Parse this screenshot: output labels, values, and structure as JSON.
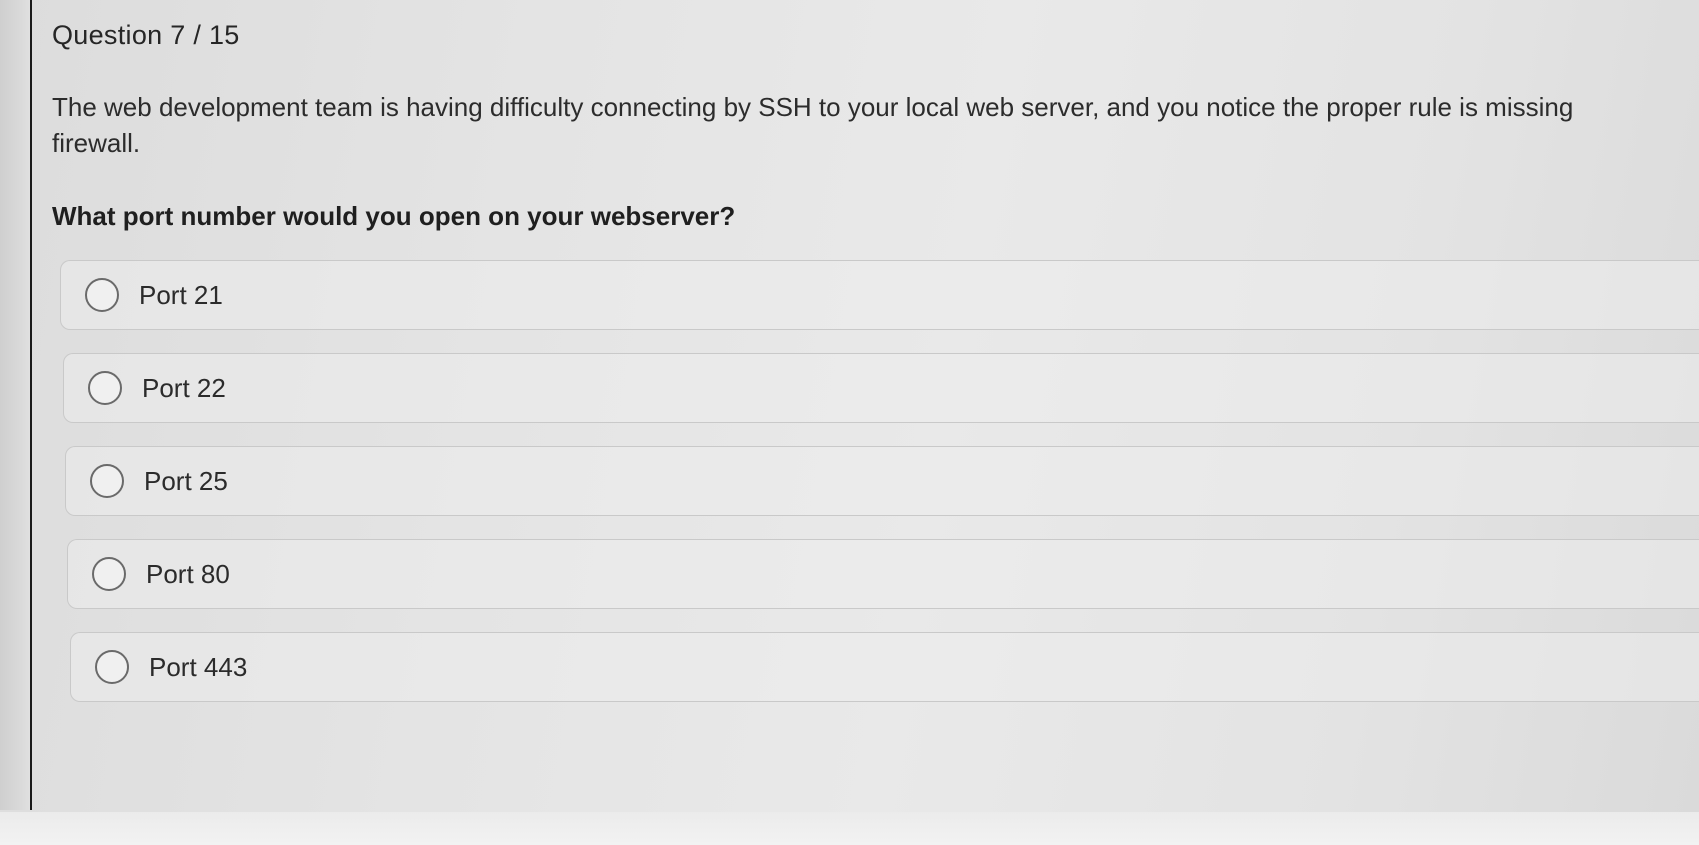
{
  "quiz": {
    "header": "Question 7 / 15",
    "question_text": "The web development team is having difficulty connecting by SSH to your local web server, and you notice the proper rule is missing",
    "question_text_line2": "firewall.",
    "prompt": "What port number would you open on your webserver?",
    "options": [
      {
        "label": "Port 21"
      },
      {
        "label": "Port 22"
      },
      {
        "label": "Port 25"
      },
      {
        "label": "Port 80"
      },
      {
        "label": "Port 443"
      }
    ]
  }
}
